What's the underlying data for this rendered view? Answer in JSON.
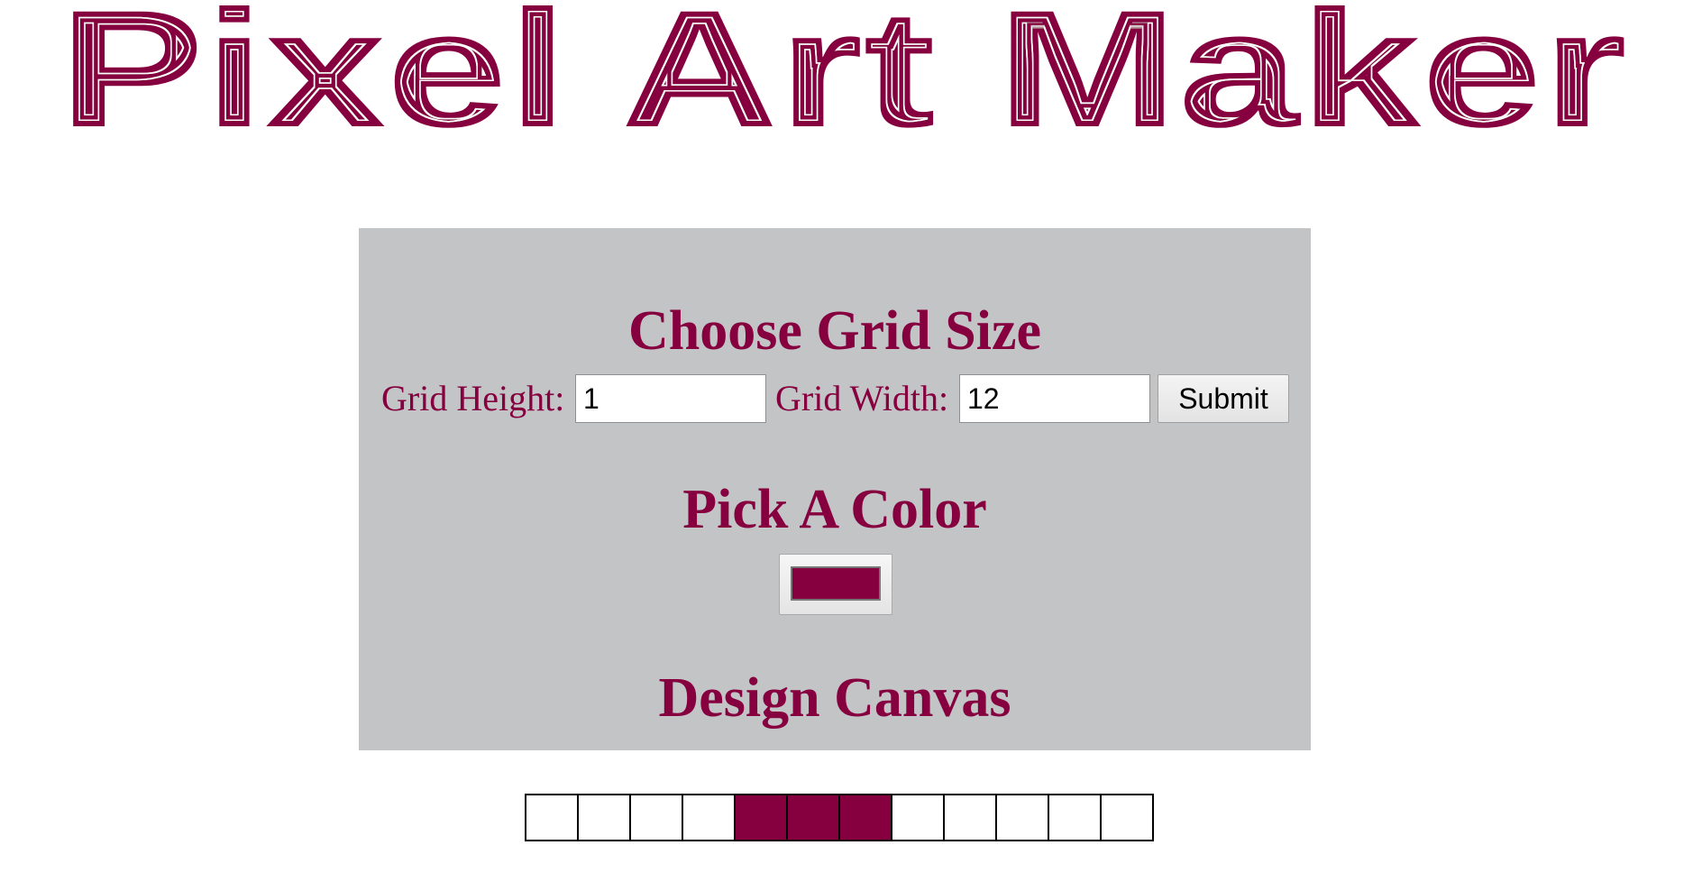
{
  "logo": {
    "text": "Pixel Art Maker",
    "color": "#86003f"
  },
  "controls": {
    "grid_title": "Choose Grid Size",
    "height_label": "Grid Height:",
    "height_value": "1",
    "width_label": "Grid Width:",
    "width_value": "12",
    "submit_label": "Submit",
    "color_title": "Pick A Color",
    "color_value": "#86003f",
    "canvas_title": "Design Canvas"
  },
  "canvas": {
    "rows": [
      [
        {
          "filled": false
        },
        {
          "filled": false
        },
        {
          "filled": false
        },
        {
          "filled": false
        },
        {
          "filled": true
        },
        {
          "filled": true
        },
        {
          "filled": true
        },
        {
          "filled": false
        },
        {
          "filled": false
        },
        {
          "filled": false
        },
        {
          "filled": false
        },
        {
          "filled": false
        }
      ]
    ],
    "fill_color": "#86003f",
    "empty_color": "#ffffff"
  },
  "theme": {
    "accent": "#86003f",
    "panel_bg": "#c3c4c6",
    "page_bg": "#ffffff"
  }
}
